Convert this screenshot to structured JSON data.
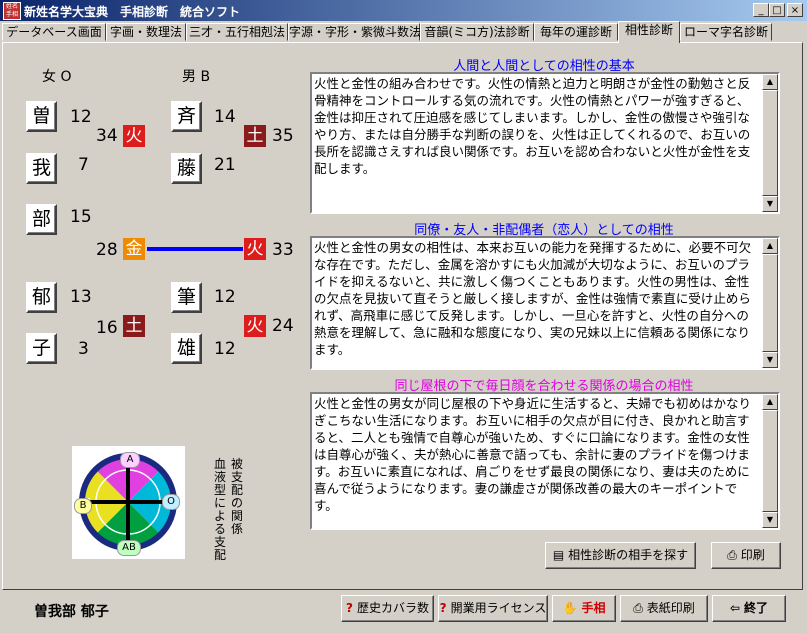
{
  "window": {
    "icon_text": "姓名手相",
    "title": "新姓名学大宝典　手相診断　統合ソフト",
    "controls": {
      "minimize": "_",
      "maximize": "□",
      "close": "×"
    }
  },
  "tabs": [
    {
      "label": "データベース画面"
    },
    {
      "label": "字画・数理法"
    },
    {
      "label": "三才・五行相剋法"
    },
    {
      "label": "字源・字形・紫微斗数法"
    },
    {
      "label": "音韻(ミコ方)法診断"
    },
    {
      "label": "毎年の運診断"
    },
    {
      "label": "相性診断"
    },
    {
      "label": "ローマ字名診断"
    }
  ],
  "female": {
    "header": "女 O",
    "chars": [
      {
        "char": "曽",
        "strokes": "12"
      },
      {
        "char": "我",
        "strokes": "7"
      },
      {
        "char": "部",
        "strokes": "15"
      },
      {
        "char": "郁",
        "strokes": "13"
      },
      {
        "char": "子",
        "strokes": "3"
      }
    ],
    "elements": [
      {
        "value": "34",
        "element": "火",
        "color": "#dd1c1c"
      },
      {
        "value": "28",
        "element": "金",
        "color": "#f08a00"
      },
      {
        "value": "16",
        "element": "土",
        "color": "#8b1a1a"
      }
    ]
  },
  "male": {
    "header": "男 B",
    "chars": [
      {
        "char": "斉",
        "strokes": "14"
      },
      {
        "char": "藤",
        "strokes": "21"
      },
      {
        "char": "筆",
        "strokes": "12"
      },
      {
        "char": "雄",
        "strokes": "12"
      }
    ],
    "elements": [
      {
        "value": "35",
        "element": "土",
        "color": "#8b1a1a"
      },
      {
        "value": "33",
        "element": "火",
        "color": "#dd1c1c"
      },
      {
        "value": "24",
        "element": "火",
        "color": "#dd1c1c"
      }
    ]
  },
  "connector_color": "#0000ff",
  "blood_chart": {
    "labels": {
      "top": "A",
      "right": "O",
      "left": "B",
      "bottom": "AB"
    },
    "caption_1": "被支配の関係",
    "caption_2": "血液型による支配"
  },
  "sections": [
    {
      "title": "人間と人間としての相性の基本",
      "title_color": "#0000ff",
      "text": "火性と金性の組み合わせです。火性の情熱と迫力と明朗さが金性の勤勉さと反骨精神をコントロールする気の流れです。火性の情熱とパワーが強すぎると、金性は抑圧されて圧迫感を感じてしまいます。しかし、金性の傲慢さや強引なやり方、または自分勝手な判断の誤りを、火性は正してくれるので、お互いの長所を認識さえすれば良い関係です。お互いを認め合わないと火性が金性を支配します。"
    },
    {
      "title": "同僚・友人・非配偶者（恋人）としての相性",
      "title_color": "#0000ff",
      "text": "火性と金性の男女の相性は、本来お互いの能力を発揮するために、必要不可欠な存在です。ただし、金属を溶かすにも火加減が大切なように、お互いのプライドを抑えるないと、共に激しく傷つくこともあります。火性の男性は、金性の欠点を見抜いて直そうと厳しく接しますが、金性は強情で素直に受け止められず、高飛車に感じて反発します。しかし、一旦心を許すと、火性の自分への熱意を理解して、急に融和な態度になり、実の兄妹以上に信頼ある関係になります。"
    },
    {
      "title": "同じ屋根の下で毎日顔を合わせる関係の場合の相性",
      "title_color": "#e000e0",
      "text": "火性と金性の男女が同じ屋根の下や身近に生活すると、夫婦でも初めはかなりぎこちない生活になります。お互いに相手の欠点が目に付き、良かれと助言すると、二人とも強情で自尊心が強いため、すぐに口論になります。金性の女性は自尊心が強く、夫が熱心に善意で語っても、余計に妻のプライドを傷つけます。お互いに素直になれば、肩ごりをせず最良の関係になり、妻は夫のために喜んで従うようになります。妻の謙虚さが関係改善の最大のキーポイントです。"
    }
  ],
  "buttons": {
    "find_partner": "相性診断の相手を探す",
    "print": "印刷"
  },
  "footer": {
    "name": "曽我部 郁子",
    "history": "歴史カバラ数",
    "license": "開業用ライセンス",
    "palm": "手相",
    "cover_print": "表紙印刷",
    "exit": "終了"
  }
}
